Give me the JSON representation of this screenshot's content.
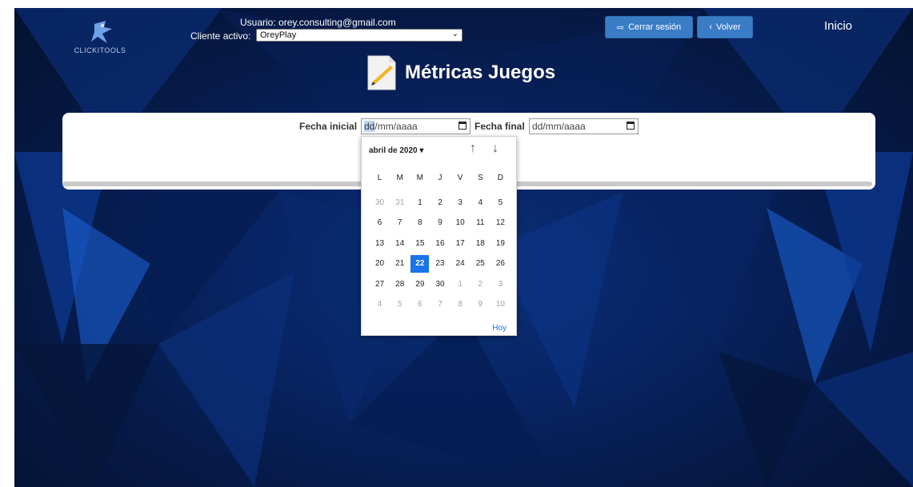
{
  "brand": {
    "logo_text": "CLICKITOOLS"
  },
  "header": {
    "user_line": "Usuario: orey.consulting@gmail.com",
    "client_label": "Cliente activo:",
    "client_value": "OreyPlay",
    "logout_label": "Cerrar sesión",
    "back_label": "Volver",
    "home_label": "Inicio"
  },
  "page": {
    "title": "Métricas Juegos"
  },
  "filters": {
    "start_label": "Fecha inicial",
    "start_placeholder_day": "dd",
    "start_placeholder_rest": "/mm/aaaa",
    "end_label": "Fecha final",
    "end_placeholder": "dd/mm/aaaa"
  },
  "datepicker": {
    "month_label": "abril de 2020 ▾",
    "prev_icon": "arrow-up-icon",
    "next_icon": "arrow-down-icon",
    "weekdays": [
      "L",
      "M",
      "M",
      "J",
      "V",
      "S",
      "D"
    ],
    "selected_day": "22",
    "today_label": "Hoy",
    "weeks": [
      [
        "30",
        "31",
        "1",
        "2",
        "3",
        "4",
        "5"
      ],
      [
        "6",
        "7",
        "8",
        "9",
        "10",
        "11",
        "12"
      ],
      [
        "13",
        "14",
        "15",
        "16",
        "17",
        "18",
        "19"
      ],
      [
        "20",
        "21",
        "22",
        "23",
        "24",
        "25",
        "26"
      ],
      [
        "27",
        "28",
        "29",
        "30",
        "1",
        "2",
        "3"
      ],
      [
        "4",
        "5",
        "6",
        "7",
        "8",
        "9",
        "10"
      ]
    ],
    "muted": [
      [
        0,
        0
      ],
      [
        0,
        1
      ],
      [
        4,
        4
      ],
      [
        4,
        5
      ],
      [
        4,
        6
      ],
      [
        5,
        0
      ],
      [
        5,
        1
      ],
      [
        5,
        2
      ],
      [
        5,
        3
      ],
      [
        5,
        4
      ],
      [
        5,
        5
      ],
      [
        5,
        6
      ]
    ]
  },
  "colors": {
    "accent": "#1a73e8",
    "button": "#3a7cc6",
    "background": "#082463"
  }
}
